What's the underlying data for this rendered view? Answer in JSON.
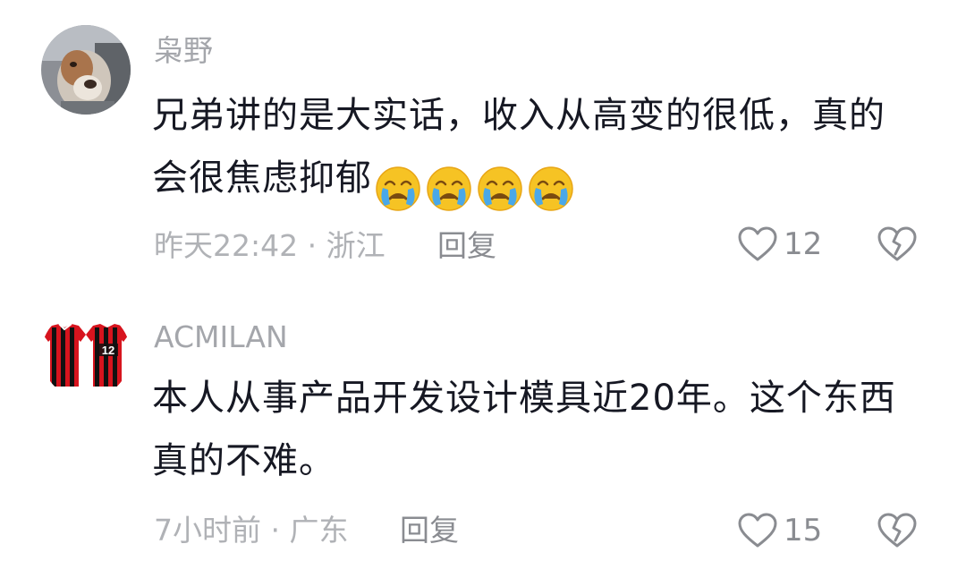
{
  "comments": [
    {
      "username": "枭野",
      "text_line1": "兄弟讲的是大实话，收入从高变的很低，真的",
      "text_line2": "会很焦虑抑郁",
      "emoji": "crying-face-icon",
      "emoji_count": 4,
      "time": "昨天22:42 · 浙江",
      "reply_label": "回复",
      "like_count": "12"
    },
    {
      "username": "ACMILAN",
      "text_line1": "本人从事产品开发设计模具近20年。这个东西",
      "text_line2": "真的不难。",
      "time": "7小时前 · 广东",
      "reply_label": "回复",
      "like_count": "15",
      "jersey_number": "12"
    }
  ],
  "colors": {
    "text": "#161823",
    "secondary": "#a4a6ab",
    "icon": "#8a8c91",
    "jersey_red": "#d7141e",
    "jersey_black": "#111111"
  }
}
